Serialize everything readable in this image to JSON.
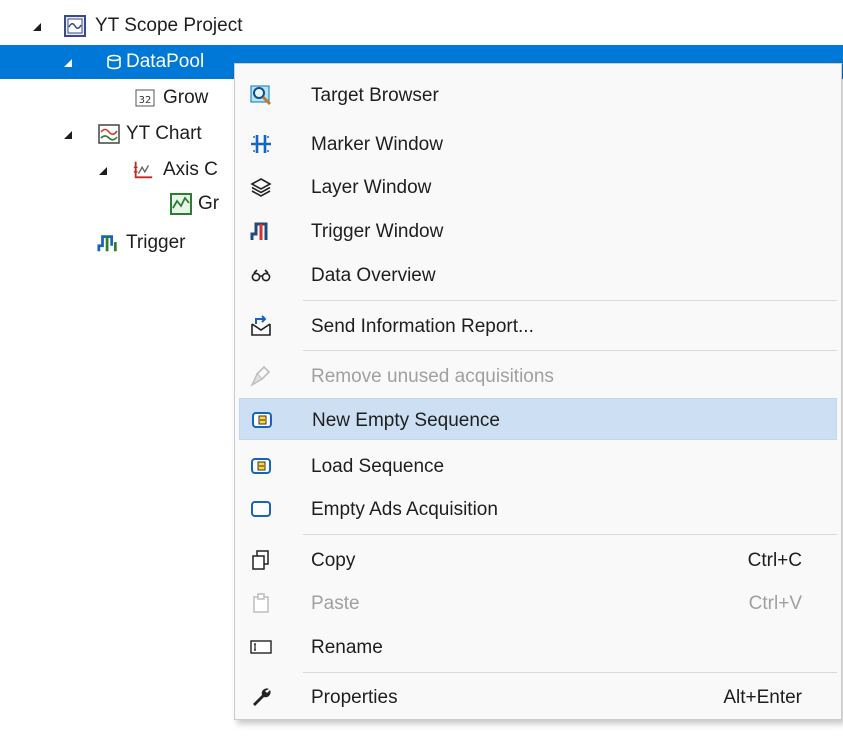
{
  "tree": {
    "items": [
      {
        "label": "YT Scope Project",
        "icon": "scope-project-icon",
        "expanded": true
      },
      {
        "label": "DataPool",
        "icon": "datapool-icon",
        "expanded": true,
        "selected": true
      },
      {
        "label": "Grow",
        "icon": "counter-32-icon"
      },
      {
        "label": "YT Chart",
        "icon": "chart-icon",
        "expanded": true
      },
      {
        "label": "Axis C",
        "icon": "axis-icon",
        "expanded": true
      },
      {
        "label": "Gr",
        "icon": "graph-icon"
      },
      {
        "label": "Trigger",
        "icon": "trigger-icon"
      }
    ]
  },
  "menu": {
    "items": [
      {
        "label": "Target Browser",
        "icon": "target-browser-icon"
      },
      {
        "label": "Marker Window",
        "icon": "marker-window-icon"
      },
      {
        "label": "Layer Window",
        "icon": "layers-icon"
      },
      {
        "label": "Trigger Window",
        "icon": "trigger-window-icon"
      },
      {
        "label": "Data Overview",
        "icon": "binoculars-icon"
      },
      {
        "label": "Send Information Report...",
        "icon": "send-report-icon"
      },
      {
        "label": "Remove unused acquisitions",
        "icon": "broom-icon",
        "disabled": true
      },
      {
        "label": "New Empty Sequence",
        "icon": "sequence-icon",
        "hover": true
      },
      {
        "label": "Load Sequence",
        "icon": "sequence-icon"
      },
      {
        "label": "Empty Ads Acquisition",
        "icon": "acquisition-icon"
      },
      {
        "label": "Copy",
        "icon": "copy-icon",
        "shortcut": "Ctrl+C"
      },
      {
        "label": "Paste",
        "icon": "paste-icon",
        "shortcut": "Ctrl+V",
        "disabled": true
      },
      {
        "label": "Rename",
        "icon": "rename-icon"
      },
      {
        "label": "Properties",
        "icon": "wrench-icon",
        "shortcut": "Alt+Enter"
      }
    ]
  },
  "colors": {
    "selection": "#0078d7",
    "menu_background": "#f9f9f9",
    "menu_hover": "#cde0f3",
    "disabled_text": "#a0a0a0"
  }
}
